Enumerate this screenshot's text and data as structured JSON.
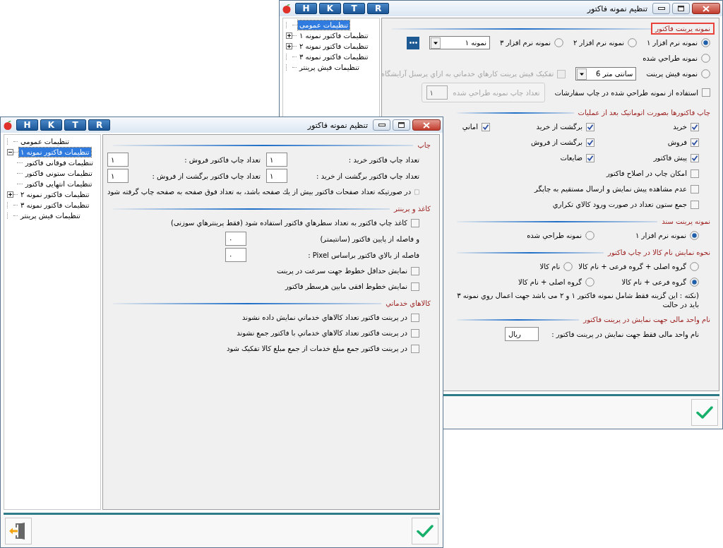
{
  "windows": [
    {
      "title": "تنظیم نمونه فاکتور",
      "toolbar": [
        "R",
        "T",
        "K",
        "H"
      ],
      "tree": [
        {
          "label": "تنظیمات عمومی",
          "selected": true
        },
        {
          "label": "تنظیمات فاکتور نمونه ۱",
          "selected": false,
          "expanded": false
        },
        {
          "label": "تنظیمات فاکتور نمونه ۲",
          "selected": false,
          "expanded": false
        },
        {
          "label": "تنظیمات فاکتور نمونه ۳",
          "selected": false
        },
        {
          "label": "تنظیمات فیش پرینتر",
          "selected": false
        }
      ],
      "sections": [
        {
          "title": "نمونه پرینت فاکتور",
          "highlighted": true,
          "kind": "options",
          "rows": [
            {
              "controls": [
                {
                  "kind": "radio",
                  "label": "نمونه نرم افزار ۱",
                  "selected": true
                },
                {
                  "kind": "radio",
                  "label": "نمونه نرم افزار ۲",
                  "selected": false
                },
                {
                  "kind": "radio",
                  "label": "نمونه نرم افزار ۳",
                  "selected": false
                },
                {
                  "kind": "combo",
                  "value": "نمونه ۱"
                },
                {
                  "kind": "more_button"
                }
              ]
            },
            {
              "controls": [
                {
                  "kind": "radio",
                  "label": "نمونه طراحي شده",
                  "selected": false
                }
              ]
            },
            {
              "controls": [
                {
                  "kind": "radio",
                  "label": "نمونه فیش پرینت",
                  "selected": false
                },
                {
                  "kind": "combo",
                  "value": "سانتی متر 6"
                },
                {
                  "kind": "checkbox",
                  "label": "تفکیک فیش پرینت کارهاي خدماتي به ازاي پرسنل آرایشگاه",
                  "checked": false,
                  "disabled": true
                }
              ]
            },
            {
              "controls": [
                {
                  "kind": "checkbox",
                  "label": "استفاده از نمونه طراحي شده در چاپ سفارشات",
                  "checked": false,
                  "disabled": false
                },
                {
                  "kind": "group_box",
                  "label": "تعداد چاپ نمونه طراحي شده",
                  "value": "۱",
                  "disabled": true
                }
              ]
            }
          ]
        },
        {
          "title": "چاپ فاکتورها بصورت اتوماتیک بعد از عملیات",
          "highlighted": false,
          "kind": "grid",
          "rows": [
            {
              "controls": [
                {
                  "kind": "checkbox",
                  "label": "خرید",
                  "checked": true,
                  "disabled": false
                },
                {
                  "kind": "checkbox",
                  "label": "برگشت از خرید",
                  "checked": true,
                  "disabled": false
                },
                {
                  "kind": "checkbox",
                  "label": "اماني",
                  "checked": true,
                  "disabled": false
                }
              ]
            },
            {
              "controls": [
                {
                  "kind": "checkbox",
                  "label": "فروش",
                  "checked": true,
                  "disabled": false
                },
                {
                  "kind": "checkbox",
                  "label": "برگشت از فروش",
                  "checked": true,
                  "disabled": false
                }
              ]
            },
            {
              "controls": [
                {
                  "kind": "checkbox",
                  "label": "پیش فاکتور",
                  "checked": true,
                  "disabled": false
                },
                {
                  "kind": "checkbox",
                  "label": "ضایعات",
                  "checked": true,
                  "disabled": false
                }
              ]
            },
            {
              "controls": [
                {
                  "kind": "checkbox",
                  "label": "امکان چاپ در اصلاح فاکتور",
                  "checked": false,
                  "disabled": false
                }
              ]
            },
            {
              "controls": [
                {
                  "kind": "checkbox",
                  "label": "عدم مشاهده پیش نمایش و ارسال مستقیم به چاپگر",
                  "checked": false,
                  "disabled": false
                }
              ]
            },
            {
              "controls": [
                {
                  "kind": "checkbox",
                  "label": "جمع ستون تعداد در صورت ورود کالاي تکراري",
                  "checked": false,
                  "disabled": false
                }
              ]
            }
          ]
        },
        {
          "title": "نمونه پرینت سند",
          "highlighted": false,
          "kind": "grid",
          "rows": [
            {
              "controls": [
                {
                  "kind": "radio",
                  "label": "نمونه نرم افزار ۱",
                  "selected": true
                },
                {
                  "kind": "radio",
                  "label": "نمونه طراحي شده",
                  "selected": false
                }
              ]
            }
          ]
        },
        {
          "title": "نحوه نمایش نام کالا در چاپ فاکتور",
          "highlighted": false,
          "kind": "grid",
          "rows": [
            {
              "controls": [
                {
                  "kind": "radio",
                  "label": "گروه اصلی + گروه فرعی + نام کالا",
                  "selected": false
                },
                {
                  "kind": "radio",
                  "label": "نام کالا",
                  "selected": false
                }
              ]
            },
            {
              "controls": [
                {
                  "kind": "radio",
                  "label": "گروه فرعی + نام کالا",
                  "selected": true
                },
                {
                  "kind": "radio",
                  "label": "گروه اصلی + نام کالا",
                  "selected": false
                }
              ]
            },
            {
              "controls": [
                {
                  "kind": "note",
                  "text": "(نکته : این گزینه فقط شامل نمونه فاکتور ۱ و ۲ می باشد جهت اعمال روي نمونه ۳ باید در حالت"
                }
              ]
            }
          ]
        },
        {
          "title": "نام واحد مالی جهت نمایش در پرینت فاکتور",
          "highlighted": false,
          "kind": "grid",
          "rows": [
            {
              "controls": [
                {
                  "kind": "field",
                  "label": "نام واحد مالی فقط جهت نمایش در پرینت فاکتور :",
                  "value": "ریال"
                }
              ]
            }
          ]
        }
      ],
      "footer": [
        {
          "kind": "confirm"
        }
      ]
    },
    {
      "title": "تنظیم نمونه فاکتور",
      "toolbar": [
        "R",
        "T",
        "K",
        "H"
      ],
      "tree": [
        {
          "label": "تنظیمات عمومی",
          "selected": false
        },
        {
          "label": "تنظیمات فاکتور نمونه ۱",
          "selected": true,
          "expanded": true,
          "children": [
            {
              "label": "تنظیمات فوقانی فاکتور",
              "selected": false
            },
            {
              "label": "تنظیمات ستونی فاکتور",
              "selected": false
            },
            {
              "label": "تنظیمات انتهایی فاکتور",
              "selected": false
            }
          ]
        },
        {
          "label": "تنظیمات فاکتور نمونه ۲",
          "selected": false,
          "expanded": false
        },
        {
          "label": "تنظیمات فاکتور نمونه ۳",
          "selected": false
        },
        {
          "label": "تنظیمات فیش پرینتر",
          "selected": false
        }
      ],
      "sections": [
        {
          "title": "چاپ",
          "highlighted": false,
          "kind": "grid",
          "rows": [
            {
              "controls": [
                {
                  "kind": "field",
                  "label": "تعداد چاپ فاکتور خرید :",
                  "value": "۱"
                },
                {
                  "kind": "field",
                  "label": "تعداد چاپ فاکتور فروش :",
                  "value": "۱"
                }
              ]
            },
            {
              "controls": [
                {
                  "kind": "field",
                  "label": "تعداد چاپ فاکتور برگشت از خرید :",
                  "value": "۱"
                },
                {
                  "kind": "field",
                  "label": "تعداد چاپ فاکتور برگشت از فروش :",
                  "value": "۱"
                }
              ]
            },
            {
              "controls": [
                {
                  "kind": "checkbox",
                  "label": "در صورتیکه تعداد صفحات فاکتور بیش از يك صفحه باشد، به تعداد فوق صفحه به صفحه چاپ گرفته شود",
                  "checked": false,
                  "disabled": false
                }
              ]
            }
          ]
        },
        {
          "title": "کاغذ و پرینتر",
          "highlighted": false,
          "kind": "grid",
          "rows": [
            {
              "controls": [
                {
                  "kind": "checkbox",
                  "label": "کاغذ چاپ فاکتور به تعداد سطرهاي فاکتور استفاده شود (فقط پرینترهاي سوزنی)",
                  "checked": false,
                  "disabled": false
                }
              ]
            },
            {
              "controls": [
                {
                  "kind": "field",
                  "label": "و فاصله از پایین فاکتور (سانتیمتر)",
                  "value": "۰"
                }
              ]
            },
            {
              "controls": [
                {
                  "kind": "field",
                  "label": "فاصله از بالاي فاکتور براساس Pixel :",
                  "value": "۰"
                }
              ]
            },
            {
              "controls": [
                {
                  "kind": "checkbox",
                  "label": "نمایش حداقل خطوط جهت سرعت در پرینت",
                  "checked": false,
                  "disabled": false
                }
              ]
            },
            {
              "controls": [
                {
                  "kind": "checkbox",
                  "label": "نمایش خطوط افقی مابین هرسطر فاکتور",
                  "checked": false,
                  "disabled": false
                }
              ]
            }
          ]
        },
        {
          "title": "کالاهاي خدماتي",
          "highlighted": false,
          "kind": "grid",
          "rows": [
            {
              "controls": [
                {
                  "kind": "checkbox",
                  "label": "در پرینت فاکتور تعداد کالاهاي خدماتي نمایش داده نشوند",
                  "checked": false,
                  "disabled": false
                }
              ]
            },
            {
              "controls": [
                {
                  "kind": "checkbox",
                  "label": "در پرینت فاکتور تعداد کالاهاي خدماتي با فاکتور جمع نشوند",
                  "checked": false,
                  "disabled": false
                }
              ]
            },
            {
              "controls": [
                {
                  "kind": "checkbox",
                  "label": "در پرینت فاکتور جمع مبلغ خدمات از جمع مبلغ کالا تفکیک شود",
                  "checked": false,
                  "disabled": false
                }
              ]
            }
          ]
        }
      ],
      "footer": [
        {
          "kind": "exit"
        },
        {
          "kind": "confirm"
        }
      ]
    }
  ]
}
